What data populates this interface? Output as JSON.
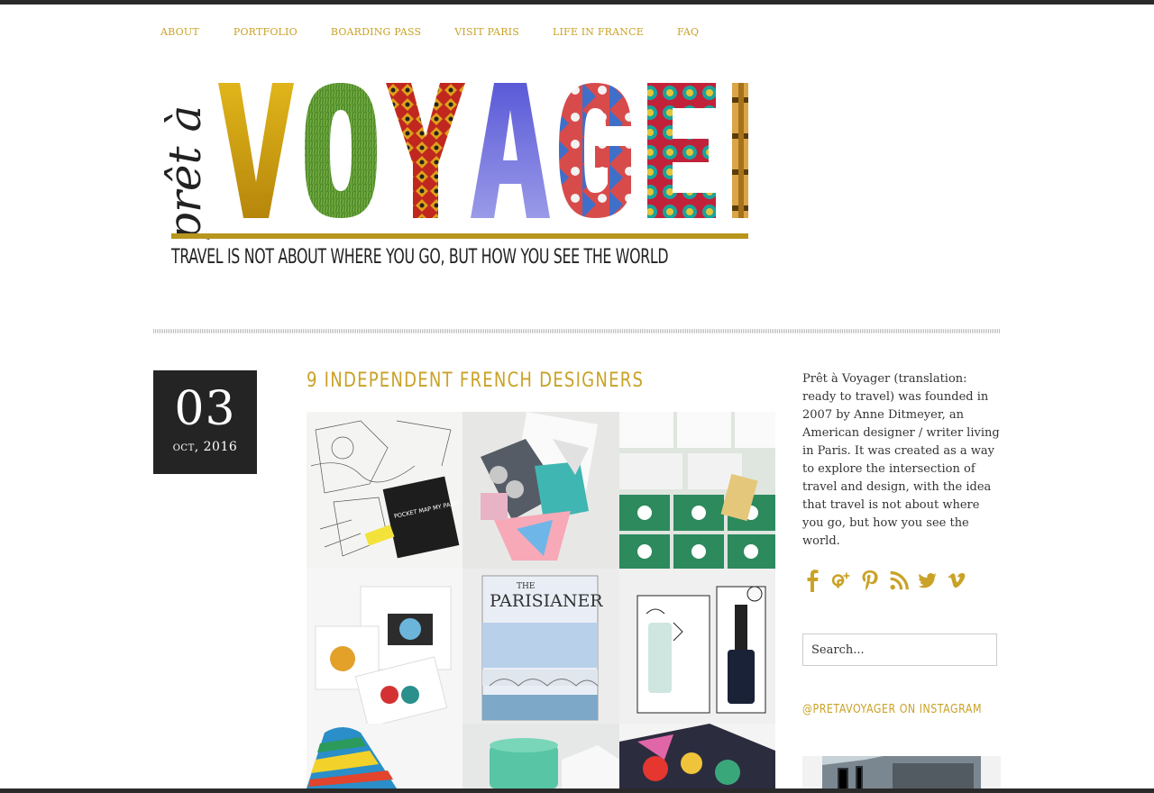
{
  "nav": {
    "items": [
      "ABOUT",
      "PORTFOLIO",
      "BOARDING PASS",
      "VISIT PARIS",
      "LIFE IN FRANCE",
      "FAQ"
    ]
  },
  "header": {
    "logo_script": "prêt à",
    "logo_word": [
      "V",
      "O",
      "Y",
      "A",
      "G",
      "E",
      "R"
    ],
    "tagline": "TRAVEL IS NOT ABOUT WHERE YOU GO, BUT HOW YOU SEE THE WORLD"
  },
  "post": {
    "date_day": "03",
    "date_month_year": "oct, 2016",
    "title": "9 INDEPENDENT FRENCH DESIGNERS",
    "collage_labels": {
      "pocket_map": "POCKET MAP MY PARIS",
      "parisianer": "PARISIANER",
      "parisianer_the": "THE"
    }
  },
  "sidebar": {
    "about_text": "Prêt à Voyager (translation: ready to travel) was founded in 2007 by Anne Ditmeyer, an American designer / writer living in Paris. It was created as a way to explore the intersection of travel and design, with the idea that travel is not about where you go, but how you see the world.",
    "social_icons": [
      "facebook-icon",
      "google-plus-icon",
      "pinterest-icon",
      "rss-icon",
      "twitter-icon",
      "vimeo-icon"
    ],
    "search_placeholder": "Search...",
    "instagram_title": "@PRETAVOYAGER ON INSTAGRAM"
  },
  "colors": {
    "accent_gold": "#c9a227",
    "dark": "#242424"
  }
}
